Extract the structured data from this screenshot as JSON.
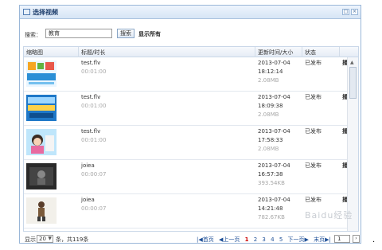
{
  "dialog": {
    "title": "选择视频",
    "min_icon": "□",
    "close_icon": "×"
  },
  "toolbar": {
    "search_label": "搜索：",
    "search_value": "教育",
    "search_button": "搜索",
    "show_all": "显示所有"
  },
  "grid": {
    "columns": [
      "缩略图",
      "标题/时长",
      "更新时间/大小",
      "状态",
      ""
    ],
    "rows": [
      {
        "title": "test.flv",
        "duration": "00:01:00",
        "date": "2013-07-04",
        "time": "18:12:14",
        "size": "2.08MB",
        "status": "已发布",
        "action": "播"
      },
      {
        "title": "test.flv",
        "duration": "00:01:00",
        "date": "2013-07-04",
        "time": "18:09:38",
        "size": "2.08MB",
        "status": "已发布",
        "action": "播"
      },
      {
        "title": "test.flv",
        "duration": "00:01:00",
        "date": "2013-07-04",
        "time": "17:58:33",
        "size": "2.08MB",
        "status": "已发布",
        "action": "播"
      },
      {
        "title": "joiea",
        "duration": "00:00:07",
        "date": "2013-07-04",
        "time": "16:57:38",
        "size": "393.54KB",
        "status": "已发布",
        "action": "播"
      },
      {
        "title": "joiea",
        "duration": "00:00:07",
        "date": "2013-07-04",
        "time": "14:21:48",
        "size": "782.67KB",
        "status": "已发布",
        "action": "播"
      }
    ]
  },
  "footer": {
    "show_label": "显示",
    "page_size": "20",
    "total": "条，共119条",
    "first": "|◀首页",
    "prev": "◀上一页",
    "pages": [
      "1",
      "2",
      "3",
      "4",
      "5"
    ],
    "next": "下一页▶",
    "last": "末页▶|",
    "page_input": "1",
    "go": "›"
  },
  "watermark": "Baidu经验",
  "colors": {
    "accent": "#9ab7d8",
    "active_page": "#cc0000",
    "link": "#1d4f97"
  }
}
